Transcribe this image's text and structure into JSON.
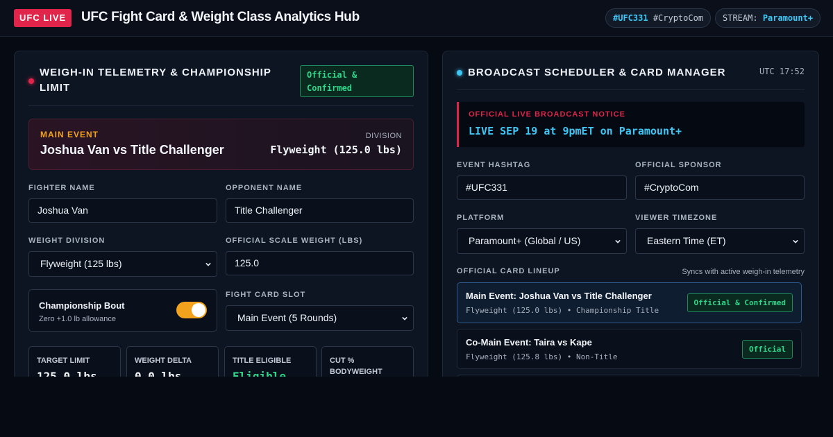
{
  "header": {
    "logo": "UFC LIVE",
    "title": "UFC Fight Card & Weight Class Analytics Hub",
    "pill_event_hashtag": "#UFC331",
    "pill_sponsor": "#CryptoCom",
    "pill_stream_label": "STREAM:",
    "pill_stream_value": "Paramount+"
  },
  "weighin": {
    "title": "WEIGH-IN TELEMETRY & CHAMPIONSHIP LIMIT",
    "status_line1": "Official &",
    "status_line2": "Confirmed",
    "main_event_label": "MAIN EVENT",
    "main_event_bout": "Joshua Van vs Title Challenger",
    "division_label": "DIVISION",
    "division_value": "Flyweight (125.0 lbs)",
    "fighter_name_label": "FIGHTER NAME",
    "fighter_name_value": "Joshua Van",
    "opponent_name_label": "OPPONENT NAME",
    "opponent_name_value": "Title Challenger",
    "weight_division_label": "WEIGHT DIVISION",
    "weight_division_value": "Flyweight (125 lbs)",
    "scale_weight_label": "OFFICIAL SCALE WEIGHT (LBS)",
    "scale_weight_value": "125.0",
    "championship_title": "Championship Bout",
    "championship_sub": "Zero +1.0 lb allowance",
    "championship_on": true,
    "fight_slot_label": "FIGHT CARD SLOT",
    "fight_slot_value": "Main Event (5 Rounds)",
    "stats": [
      {
        "label": "TARGET LIMIT",
        "value": "125.0 lbs"
      },
      {
        "label": "WEIGHT DELTA",
        "value": "0.0 lbs"
      },
      {
        "label": "TITLE ELIGIBLE",
        "value": "Eligible"
      },
      {
        "label": "CUT % BODYWEIGHT",
        "value": ""
      }
    ]
  },
  "broadcast": {
    "title": "BROADCAST SCHEDULER & CARD MANAGER",
    "clock": "UTC 17:52",
    "notice_label": "OFFICIAL LIVE BROADCAST NOTICE",
    "notice_message": "LIVE SEP 19 at 9pmET on Paramount+",
    "hashtag_label": "EVENT HASHTAG",
    "hashtag_value": "#UFC331",
    "sponsor_label": "OFFICIAL SPONSOR",
    "sponsor_value": "#CryptoCom",
    "platform_label": "PLATFORM",
    "platform_value": "Paramount+ (Global / US)",
    "timezone_label": "VIEWER TIMEZONE",
    "timezone_value": "Eastern Time (ET)",
    "lineup_label": "OFFICIAL CARD LINEUP",
    "lineup_sync": "Syncs with active weigh-in telemetry",
    "bouts": [
      {
        "title": "Main Event: Joshua Van vs Title Challenger",
        "sub": "Flyweight (125.0 lbs) • Championship Title",
        "tag": "Official & Confirmed"
      },
      {
        "title": "Co-Main Event: Taira vs Kape",
        "sub": "Flyweight (125.8 lbs) • Non-Title",
        "tag": "Official"
      }
    ]
  },
  "colors": {
    "accent_red": "#e0244a",
    "accent_blue": "#3ec7f5",
    "accent_orange": "#f2a21c",
    "accent_green": "#2fd88a",
    "background": "#060a12"
  },
  "icons": [
    "chevron-down-icon",
    "status-dot-icon"
  ]
}
